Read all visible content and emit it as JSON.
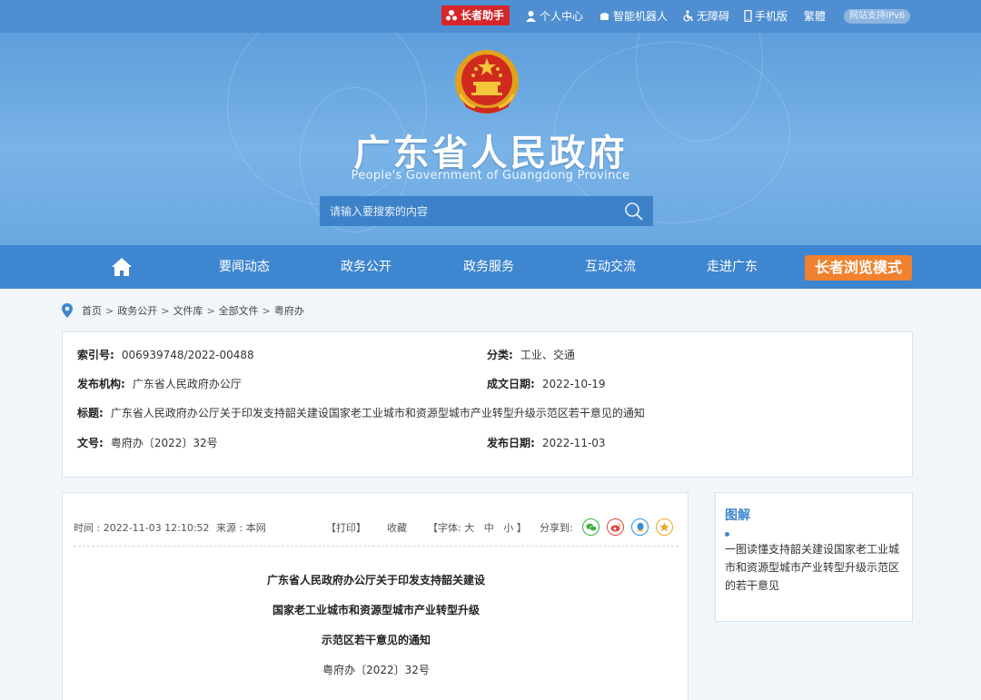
{
  "topbar": {
    "assistant_label": "长者助手",
    "links": [
      "个人中心",
      "智能机器人",
      "无障碍",
      "手机版",
      "繁體"
    ],
    "ipv6": "网站支持IPv6"
  },
  "banner": {
    "title": "广东省人民政府",
    "subtitle": "People's Government of Guangdong Province",
    "search_placeholder": "请输入要搜索的内容"
  },
  "nav": {
    "items": [
      "要闻动态",
      "政务公开",
      "政务服务",
      "互动交流",
      "走进广东"
    ],
    "elder_mode": "长者浏览模式"
  },
  "breadcrumb": [
    "首页",
    "政务公开",
    "文件库",
    "全部文件",
    "粤府办"
  ],
  "info": {
    "index_label": "索引号:",
    "index_value": "006939748/2022-00488",
    "category_label": "分类:",
    "category_value": "工业、交通",
    "publisher_label": "发布机构:",
    "publisher_value": "广东省人民政府办公厅",
    "created_label": "成文日期:",
    "created_value": "2022-10-19",
    "title_label": "标题:",
    "title_value": "广东省人民政府办公厅关于印发支持韶关建设国家老工业城市和资源型城市产业转型升级示范区若干意见的通知",
    "docno_label": "文号:",
    "docno_value": "粤府办〔2022〕32号",
    "published_label": "发布日期:",
    "published_value": "2022-11-03"
  },
  "article": {
    "time": "时间 : 2022-11-03 12:10:52",
    "source": "来源 : 本网",
    "print": "【打印】",
    "favorite": "收藏",
    "font_label": "【字体:",
    "font_large": "大",
    "font_medium": "中",
    "font_small": "小",
    "font_close": "】",
    "share_label": "分享到:",
    "title_line1": "广东省人民政府办公厅关于印发支持韶关建设",
    "title_line2": "国家老工业城市和资源型城市产业转型升级",
    "title_line3": "示范区若干意见的通知",
    "doc_number": "粤府办〔2022〕32号"
  },
  "side": {
    "title": "图解",
    "link": "一图读懂支持韶关建设国家老工业城市和资源型城市产业转型升级示范区的若干意见"
  },
  "colors": {
    "topbar": "#4f8ed0",
    "nav": "#3e86cf",
    "elder": "#f0812e",
    "assistant": "#d6262a",
    "wechat": "#3aae3a",
    "weibo": "#e2453c",
    "qq": "#2f8fd6",
    "qzone": "#f2a623"
  },
  "icons": [
    "user-icon",
    "robot-icon",
    "accessibility-icon",
    "mobile-icon",
    "search-icon",
    "home-icon",
    "location-pin-icon",
    "wechat-icon",
    "weibo-icon",
    "qq-icon",
    "qzone-icon",
    "national-emblem"
  ]
}
